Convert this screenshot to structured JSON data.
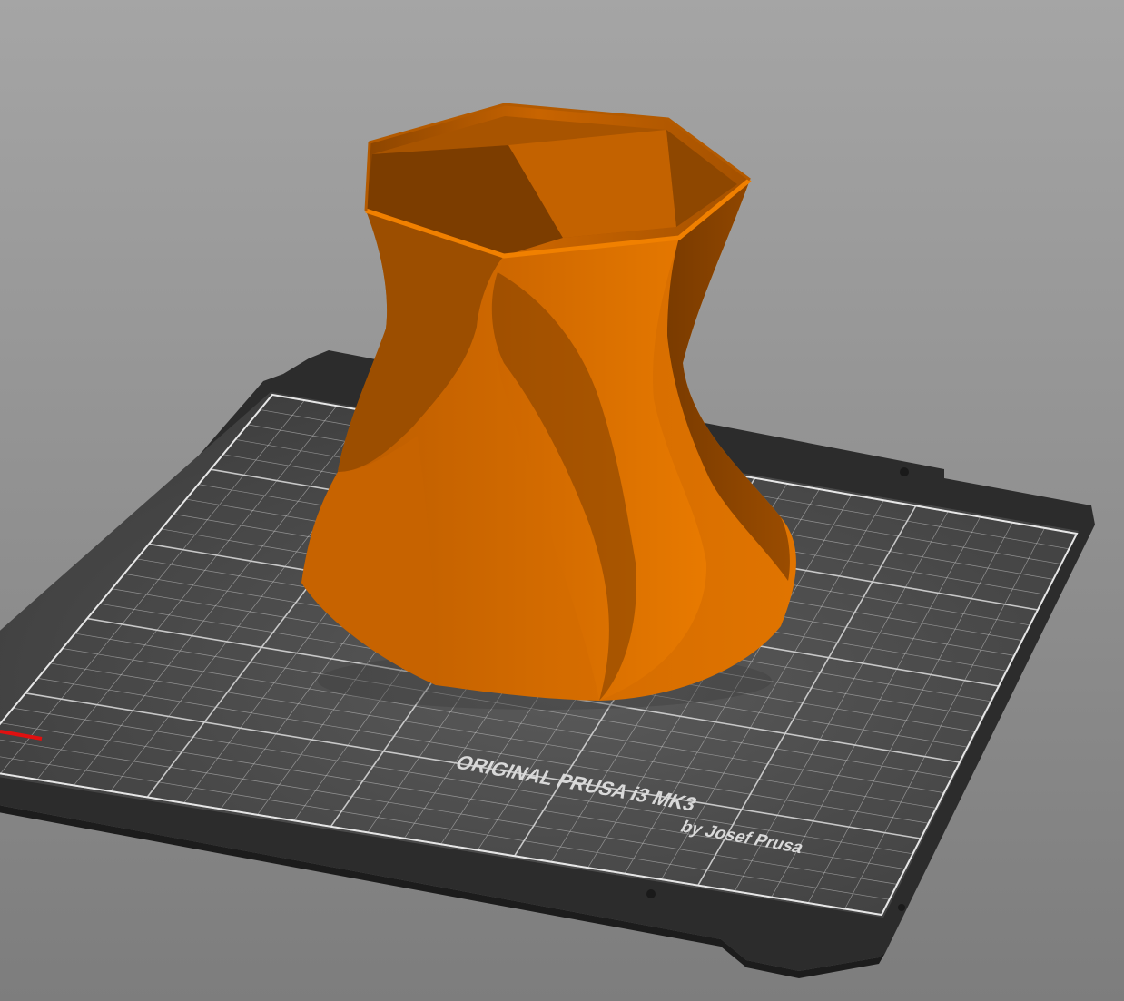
{
  "viewport": {
    "background_top": "#a4a4a4",
    "background_bottom": "#7e7e7e"
  },
  "bed": {
    "brand_label": "ORIGINAL PRUSA i3 MK3",
    "maker_label": "by Josef Prusa",
    "plate_color": "#2b2b2b",
    "sheet_color": "#454545",
    "grid_color": "#cfcfcf"
  },
  "model": {
    "name_icon": "twisted-vase-model",
    "color": "#d86d00"
  },
  "axis": {
    "x_color": "#e01010"
  }
}
